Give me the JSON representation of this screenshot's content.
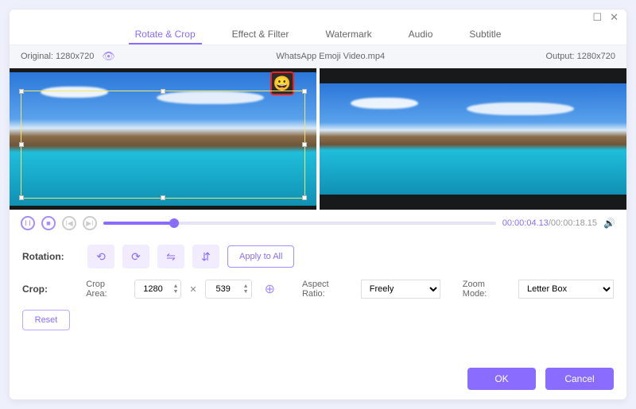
{
  "window": {
    "maximize": "☐",
    "close": "✕"
  },
  "tabs": [
    "Rotate & Crop",
    "Effect & Filter",
    "Watermark",
    "Audio",
    "Subtitle"
  ],
  "active_tab": 0,
  "info": {
    "original_label": "Original: 1280x720",
    "filename": "WhatsApp Emoji Video.mp4",
    "output_label": "Output: 1280x720"
  },
  "playback": {
    "current": "00:00:04.13",
    "duration": "/00:00:18.15",
    "progress_pct": 18
  },
  "rotation": {
    "label": "Rotation:",
    "apply_all": "Apply to All"
  },
  "crop": {
    "label": "Crop:",
    "area_label": "Crop Area:",
    "width": "1280",
    "height": "539",
    "aspect_label": "Aspect Ratio:",
    "aspect_value": "Freely",
    "zoom_label": "Zoom Mode:",
    "zoom_value": "Letter Box",
    "reset": "Reset"
  },
  "footer": {
    "ok": "OK",
    "cancel": "Cancel"
  }
}
